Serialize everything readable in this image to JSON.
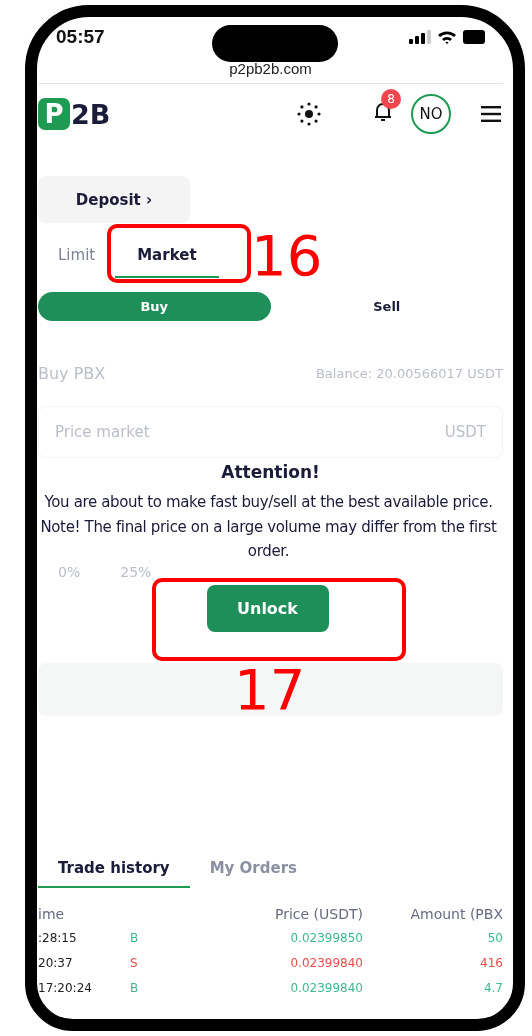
{
  "status_bar": {
    "time": "05:57"
  },
  "browser": {
    "url": "p2pb2b.com"
  },
  "header": {
    "logo_mark": "P",
    "logo_text": "2B",
    "notifications": "8",
    "avatar": "NO"
  },
  "deposit_button": {
    "label": "Deposit",
    "arrow": "›"
  },
  "order_tabs": [
    {
      "label": "Limit",
      "selected": false
    },
    {
      "label": "Market",
      "selected": true
    }
  ],
  "side_switch": [
    {
      "label": "Buy",
      "selected": true
    },
    {
      "label": "Sell",
      "selected": false
    }
  ],
  "form": {
    "title": "Buy PBX",
    "balance": "Balance: 20.00566017 USDT",
    "price_placeholder": "Price market",
    "price_unit": "USDT",
    "percents": [
      "0%",
      "25%"
    ],
    "submit_bar": true
  },
  "attention": {
    "title": "Attention!",
    "message": "You are about to make fast buy/sell at the best available price. Note! The final price on a large volume may differ from the first order.",
    "button": "Unlock"
  },
  "annotations": [
    {
      "label": "16"
    },
    {
      "label": "17"
    }
  ],
  "history_tabs": [
    {
      "label": "Trade history",
      "selected": true
    },
    {
      "label": "My Orders",
      "selected": false
    }
  ],
  "table": {
    "columns": [
      "ime",
      "Price (USDT)",
      "Amount (PBX"
    ],
    "rows": [
      {
        "time": ":28:15",
        "side": "B",
        "price": "0.02399850",
        "amount": "50"
      },
      {
        "time": "20:37",
        "side": "S",
        "price": "0.02399840",
        "amount": "416"
      },
      {
        "time": "17:20:24",
        "side": "B",
        "price": "0.02399840",
        "amount": "4.7"
      }
    ]
  }
}
